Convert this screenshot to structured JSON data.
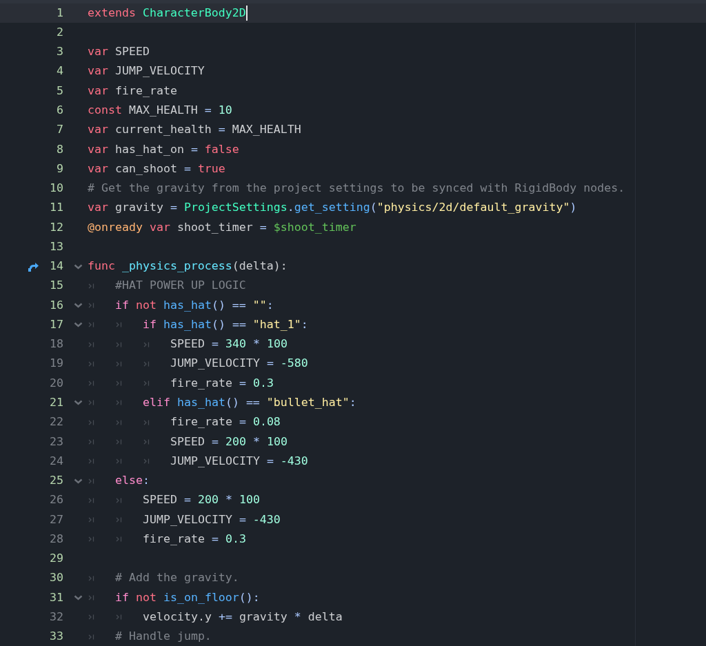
{
  "editor": {
    "lines": [
      {
        "number": "1",
        "safe": true,
        "foldable": false,
        "current": true,
        "tokens": [
          {
            "kind": "keyword",
            "text": "extends"
          },
          {
            "kind": "type",
            "text": " CharacterBody2D"
          }
        ]
      },
      {
        "number": "2",
        "safe": true,
        "foldable": false,
        "current": false
      },
      {
        "number": "3",
        "safe": true,
        "foldable": false,
        "current": false,
        "tokens": [
          {
            "kind": "keyword",
            "text": "var"
          },
          {
            "kind": "plain",
            "text": " SPEED"
          }
        ]
      },
      {
        "number": "4",
        "safe": true,
        "foldable": false,
        "current": false,
        "tokens": [
          {
            "kind": "keyword",
            "text": "var"
          },
          {
            "kind": "plain",
            "text": " JUMP_VELOCITY"
          }
        ]
      },
      {
        "number": "5",
        "safe": true,
        "foldable": false,
        "current": false,
        "tokens": [
          {
            "kind": "keyword",
            "text": "var"
          },
          {
            "kind": "plain",
            "text": " fire_rate"
          }
        ]
      },
      {
        "number": "6",
        "safe": true,
        "foldable": false,
        "current": false,
        "tokens": [
          {
            "kind": "keyword",
            "text": "const"
          },
          {
            "kind": "plain",
            "text": " MAX_HEALTH "
          },
          {
            "kind": "symbol",
            "text": "="
          },
          {
            "kind": "number",
            "text": " 10"
          }
        ]
      },
      {
        "number": "7",
        "safe": true,
        "foldable": false,
        "current": false,
        "tokens": [
          {
            "kind": "keyword",
            "text": "var"
          },
          {
            "kind": "plain",
            "text": " current_health "
          },
          {
            "kind": "symbol",
            "text": "="
          },
          {
            "kind": "plain",
            "text": " MAX_HEALTH"
          }
        ]
      },
      {
        "number": "8",
        "safe": true,
        "foldable": false,
        "current": false,
        "tokens": [
          {
            "kind": "keyword",
            "text": "var"
          },
          {
            "kind": "plain",
            "text": " has_hat_on "
          },
          {
            "kind": "symbol",
            "text": "="
          },
          {
            "kind": "keyword",
            "text": " false"
          }
        ]
      },
      {
        "number": "9",
        "safe": true,
        "foldable": false,
        "current": false,
        "tokens": [
          {
            "kind": "keyword",
            "text": "var"
          },
          {
            "kind": "plain",
            "text": " can_shoot "
          },
          {
            "kind": "symbol",
            "text": "="
          },
          {
            "kind": "keyword",
            "text": " true"
          }
        ]
      },
      {
        "number": "10",
        "safe": true,
        "foldable": false,
        "current": false,
        "tokens": [
          {
            "kind": "comment",
            "text": "# Get the gravity from the project settings to be synced with RigidBody nodes."
          }
        ]
      },
      {
        "number": "11",
        "safe": true,
        "foldable": false,
        "current": false,
        "tokens": [
          {
            "kind": "keyword",
            "text": "var"
          },
          {
            "kind": "plain",
            "text": " gravity "
          },
          {
            "kind": "symbol",
            "text": "="
          },
          {
            "kind": "type",
            "text": " ProjectSettings"
          },
          {
            "kind": "symbol",
            "text": "."
          },
          {
            "kind": "call",
            "text": "get_setting"
          },
          {
            "kind": "symbol",
            "text": "("
          },
          {
            "kind": "string",
            "text": "\"physics/2d/default_gravity\""
          },
          {
            "kind": "symbol",
            "text": ")"
          }
        ]
      },
      {
        "number": "12",
        "safe": true,
        "foldable": false,
        "current": false,
        "tokens": [
          {
            "kind": "annotation",
            "text": "@onready"
          },
          {
            "kind": "keyword",
            "text": " var"
          },
          {
            "kind": "plain",
            "text": " shoot_timer "
          },
          {
            "kind": "symbol",
            "text": "="
          },
          {
            "kind": "nodepath",
            "text": " $shoot_timer"
          }
        ]
      },
      {
        "number": "13",
        "safe": true,
        "foldable": false,
        "current": false
      },
      {
        "number": "14",
        "safe": true,
        "foldable": true,
        "current": false,
        "gutter": {
          "kind": "override"
        },
        "tokens": [
          {
            "kind": "keyword",
            "text": "func"
          },
          {
            "kind": "funcname",
            "text": " _physics_process"
          },
          {
            "kind": "plain",
            "text": "(delta):"
          }
        ]
      },
      {
        "number": "15",
        "safe": true,
        "foldable": false,
        "current": false,
        "tokens": [
          {
            "kind": "tab"
          },
          {
            "kind": "comment",
            "text": "#HAT POWER UP LOGIC"
          }
        ]
      },
      {
        "number": "16",
        "safe": true,
        "foldable": true,
        "current": false,
        "tokens": [
          {
            "kind": "tab"
          },
          {
            "kind": "flow",
            "text": "if"
          },
          {
            "kind": "keyword",
            "text": " not"
          },
          {
            "kind": "call",
            "text": " has_hat"
          },
          {
            "kind": "symbol",
            "text": "() =="
          },
          {
            "kind": "string",
            "text": " \"\""
          },
          {
            "kind": "symbol",
            "text": ":"
          }
        ]
      },
      {
        "number": "17",
        "safe": true,
        "foldable": true,
        "current": false,
        "tokens": [
          {
            "kind": "tab"
          },
          {
            "kind": "tab"
          },
          {
            "kind": "flow",
            "text": "if"
          },
          {
            "kind": "call",
            "text": " has_hat"
          },
          {
            "kind": "symbol",
            "text": "() =="
          },
          {
            "kind": "string",
            "text": " \"hat_1\""
          },
          {
            "kind": "symbol",
            "text": ":"
          }
        ]
      },
      {
        "number": "18",
        "safe": false,
        "foldable": false,
        "current": false,
        "tokens": [
          {
            "kind": "tab"
          },
          {
            "kind": "tab"
          },
          {
            "kind": "tab"
          },
          {
            "kind": "plain",
            "text": "SPEED "
          },
          {
            "kind": "symbol",
            "text": "="
          },
          {
            "kind": "number",
            "text": " 340"
          },
          {
            "kind": "symbol",
            "text": " *"
          },
          {
            "kind": "number",
            "text": " 100"
          }
        ]
      },
      {
        "number": "19",
        "safe": false,
        "foldable": false,
        "current": false,
        "tokens": [
          {
            "kind": "tab"
          },
          {
            "kind": "tab"
          },
          {
            "kind": "tab"
          },
          {
            "kind": "plain",
            "text": "JUMP_VELOCITY "
          },
          {
            "kind": "symbol",
            "text": "="
          },
          {
            "kind": "number",
            "text": " -580"
          }
        ]
      },
      {
        "number": "20",
        "safe": false,
        "foldable": false,
        "current": false,
        "tokens": [
          {
            "kind": "tab"
          },
          {
            "kind": "tab"
          },
          {
            "kind": "tab"
          },
          {
            "kind": "plain",
            "text": "fire_rate "
          },
          {
            "kind": "symbol",
            "text": "="
          },
          {
            "kind": "number",
            "text": " 0.3"
          }
        ]
      },
      {
        "number": "21",
        "safe": true,
        "foldable": true,
        "current": false,
        "tokens": [
          {
            "kind": "tab"
          },
          {
            "kind": "tab"
          },
          {
            "kind": "flow",
            "text": "elif"
          },
          {
            "kind": "call",
            "text": " has_hat"
          },
          {
            "kind": "symbol",
            "text": "() =="
          },
          {
            "kind": "string",
            "text": " \"bullet_hat\""
          },
          {
            "kind": "symbol",
            "text": ":"
          }
        ]
      },
      {
        "number": "22",
        "safe": false,
        "foldable": false,
        "current": false,
        "tokens": [
          {
            "kind": "tab"
          },
          {
            "kind": "tab"
          },
          {
            "kind": "tab"
          },
          {
            "kind": "plain",
            "text": "fire_rate "
          },
          {
            "kind": "symbol",
            "text": "="
          },
          {
            "kind": "number",
            "text": " 0.08"
          }
        ]
      },
      {
        "number": "23",
        "safe": false,
        "foldable": false,
        "current": false,
        "tokens": [
          {
            "kind": "tab"
          },
          {
            "kind": "tab"
          },
          {
            "kind": "tab"
          },
          {
            "kind": "plain",
            "text": "SPEED "
          },
          {
            "kind": "symbol",
            "text": "="
          },
          {
            "kind": "number",
            "text": " 200"
          },
          {
            "kind": "symbol",
            "text": " *"
          },
          {
            "kind": "number",
            "text": " 100"
          }
        ]
      },
      {
        "number": "24",
        "safe": false,
        "foldable": false,
        "current": false,
        "tokens": [
          {
            "kind": "tab"
          },
          {
            "kind": "tab"
          },
          {
            "kind": "tab"
          },
          {
            "kind": "plain",
            "text": "JUMP_VELOCITY "
          },
          {
            "kind": "symbol",
            "text": "="
          },
          {
            "kind": "number",
            "text": " -430"
          }
        ]
      },
      {
        "number": "25",
        "safe": true,
        "foldable": true,
        "current": false,
        "tokens": [
          {
            "kind": "tab"
          },
          {
            "kind": "flow",
            "text": "else"
          },
          {
            "kind": "symbol",
            "text": ":"
          }
        ]
      },
      {
        "number": "26",
        "safe": false,
        "foldable": false,
        "current": false,
        "tokens": [
          {
            "kind": "tab"
          },
          {
            "kind": "tab"
          },
          {
            "kind": "plain",
            "text": "SPEED "
          },
          {
            "kind": "symbol",
            "text": "="
          },
          {
            "kind": "number",
            "text": " 200"
          },
          {
            "kind": "symbol",
            "text": " *"
          },
          {
            "kind": "number",
            "text": " 100"
          }
        ]
      },
      {
        "number": "27",
        "safe": false,
        "foldable": false,
        "current": false,
        "tokens": [
          {
            "kind": "tab"
          },
          {
            "kind": "tab"
          },
          {
            "kind": "plain",
            "text": "JUMP_VELOCITY "
          },
          {
            "kind": "symbol",
            "text": "="
          },
          {
            "kind": "number",
            "text": " -430"
          }
        ]
      },
      {
        "number": "28",
        "safe": false,
        "foldable": false,
        "current": false,
        "tokens": [
          {
            "kind": "tab"
          },
          {
            "kind": "tab"
          },
          {
            "kind": "plain",
            "text": "fire_rate "
          },
          {
            "kind": "symbol",
            "text": "="
          },
          {
            "kind": "number",
            "text": " 0.3"
          }
        ]
      },
      {
        "number": "29",
        "safe": true,
        "foldable": false,
        "current": false
      },
      {
        "number": "30",
        "safe": true,
        "foldable": false,
        "current": false,
        "tokens": [
          {
            "kind": "tab"
          },
          {
            "kind": "comment",
            "text": "# Add the gravity."
          }
        ]
      },
      {
        "number": "31",
        "safe": true,
        "foldable": true,
        "current": false,
        "tokens": [
          {
            "kind": "tab"
          },
          {
            "kind": "flow",
            "text": "if"
          },
          {
            "kind": "keyword",
            "text": " not"
          },
          {
            "kind": "call",
            "text": " is_on_floor"
          },
          {
            "kind": "symbol",
            "text": "():"
          }
        ]
      },
      {
        "number": "32",
        "safe": false,
        "foldable": false,
        "current": false,
        "tokens": [
          {
            "kind": "tab"
          },
          {
            "kind": "tab"
          },
          {
            "kind": "plain",
            "text": "velocity.y "
          },
          {
            "kind": "symbol",
            "text": "+="
          },
          {
            "kind": "plain",
            "text": " gravity "
          },
          {
            "kind": "symbol",
            "text": "*"
          },
          {
            "kind": "plain",
            "text": " delta"
          }
        ]
      },
      {
        "number": "33",
        "safe": true,
        "foldable": false,
        "current": false,
        "tokens": [
          {
            "kind": "tab"
          },
          {
            "kind": "comment",
            "text": "# Handle jump."
          }
        ]
      }
    ]
  }
}
